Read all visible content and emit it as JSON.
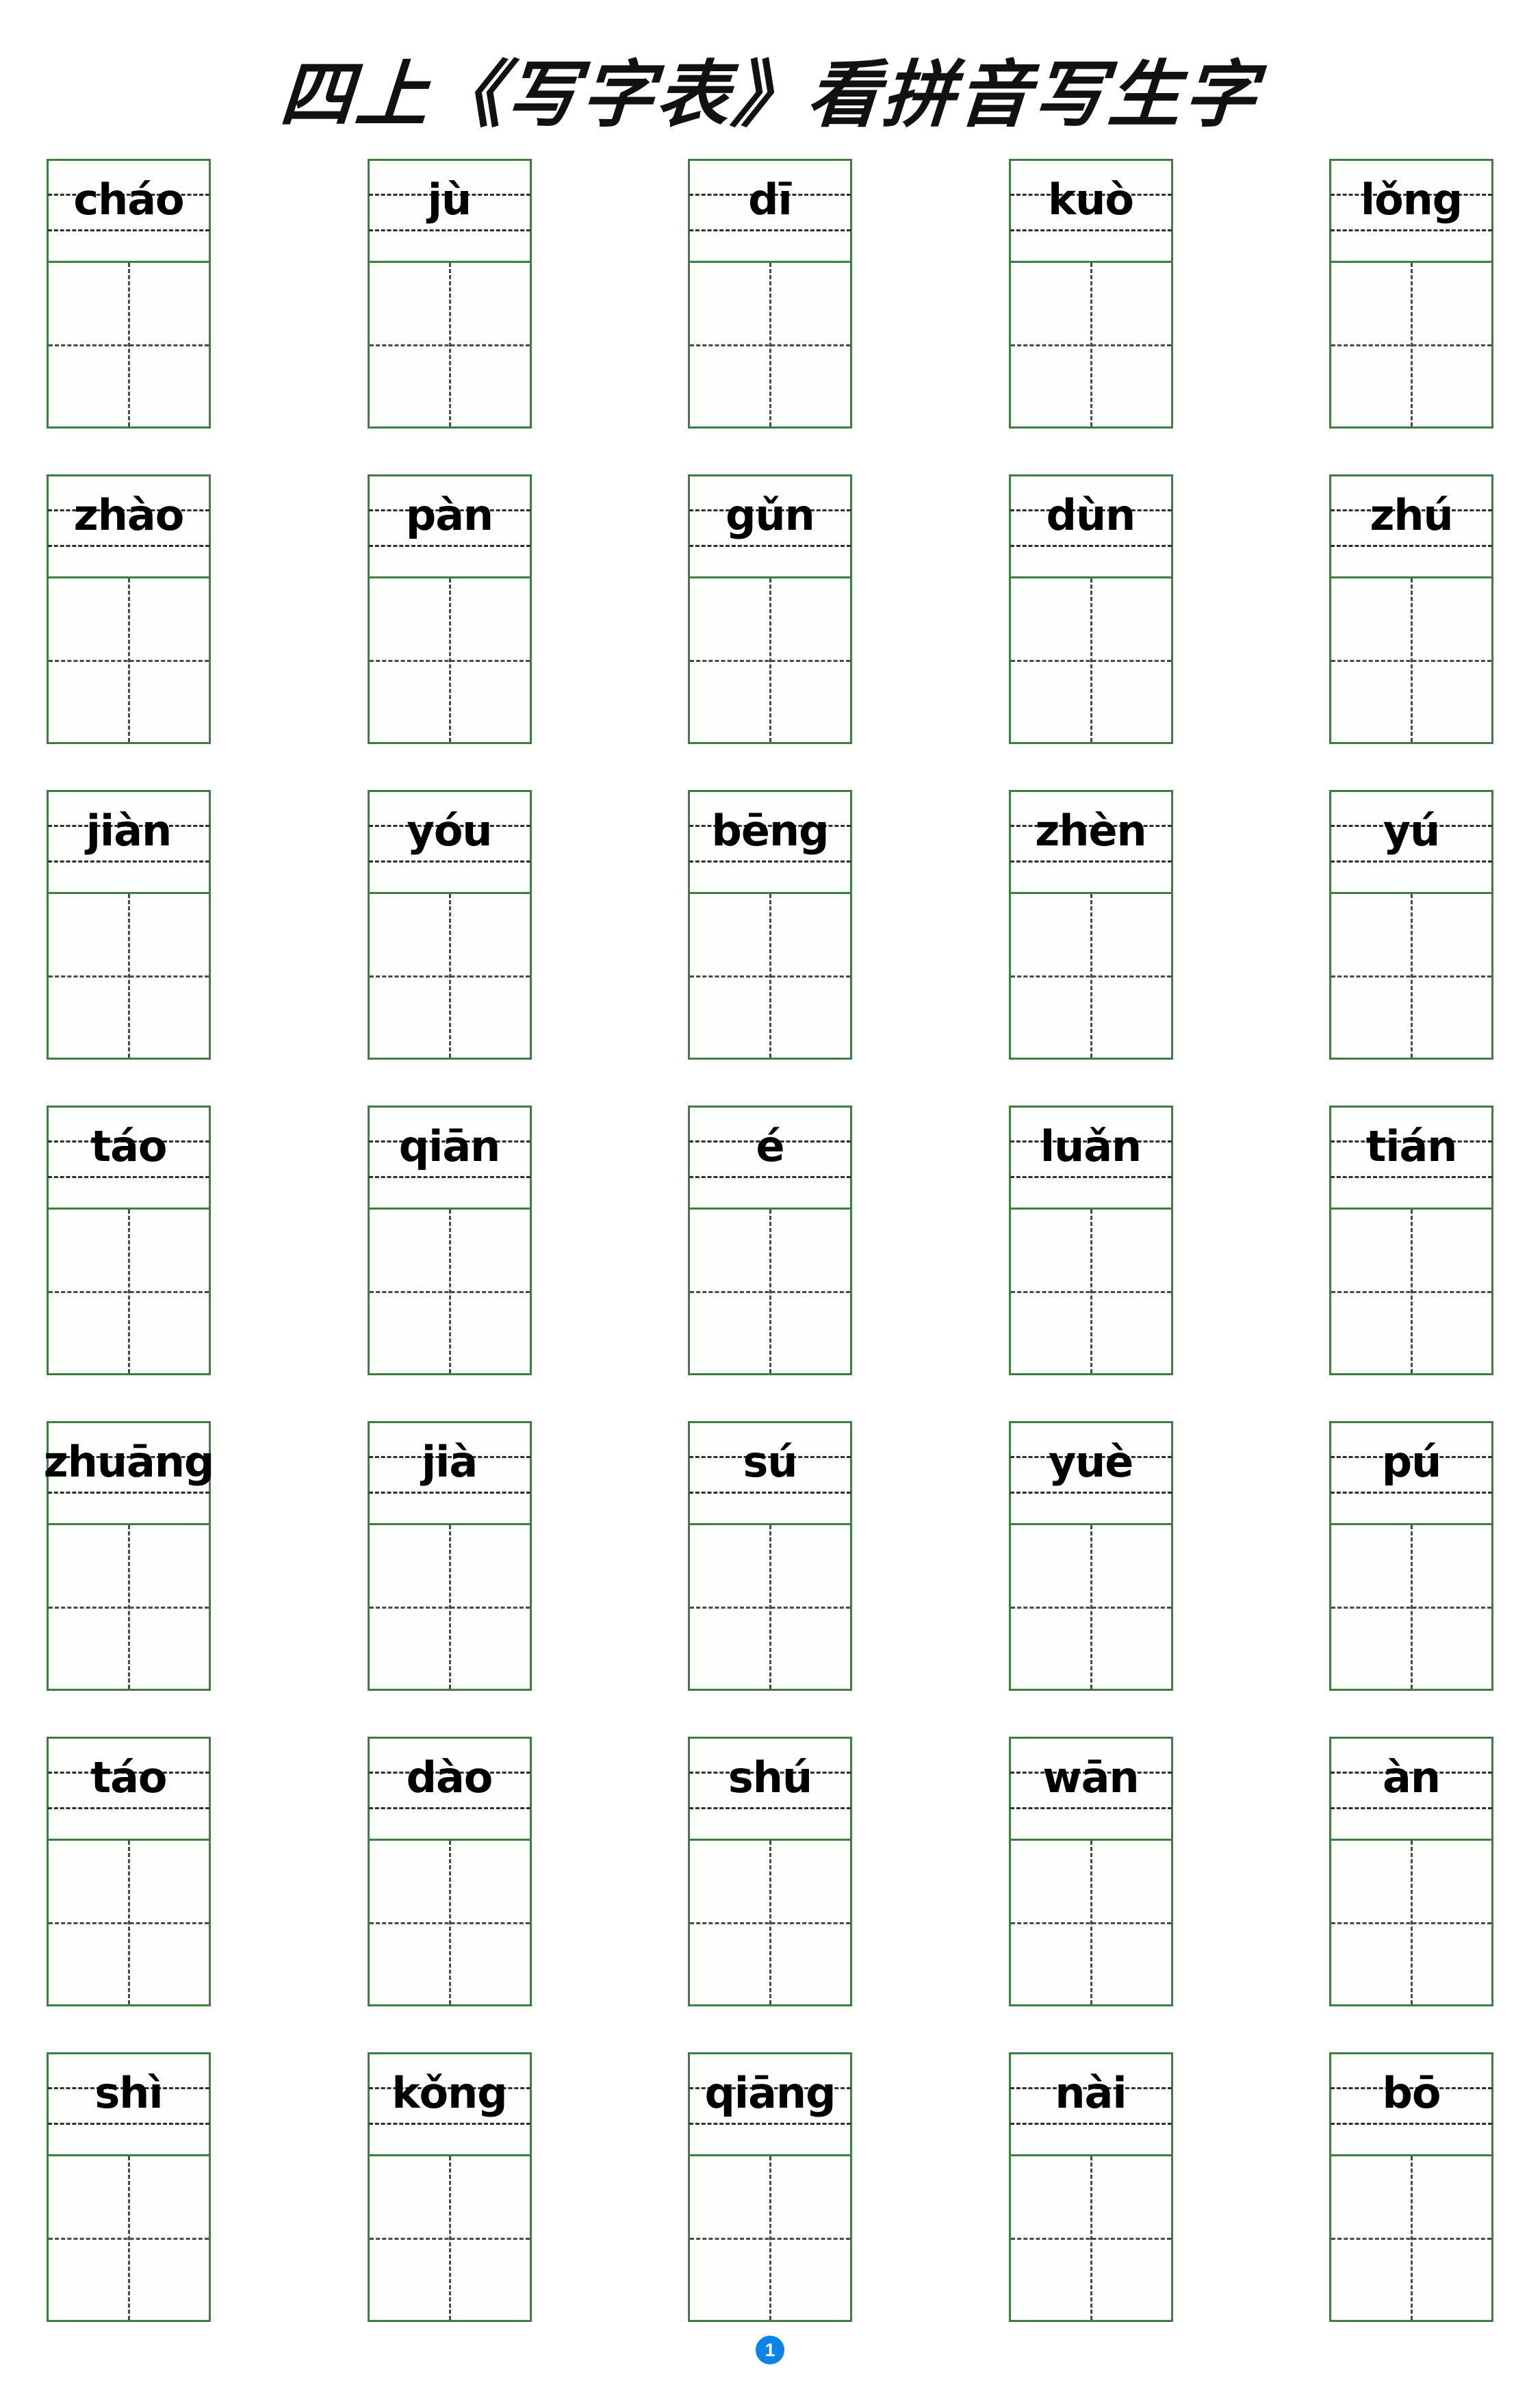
{
  "document": {
    "title": "四上《写字表》看拼音写生字",
    "page_number": "1",
    "page_badge_color": "#0a84e8",
    "grid_line_color": "#3f7d42",
    "guide_line_color": "#2f2f2f"
  },
  "worksheet": {
    "columns": 5,
    "rows": 7,
    "cell_structure": {
      "pinyin_guide": "four-line-three-grid",
      "character_grid": "tian-zi-ge"
    },
    "entries": [
      [
        {
          "pinyin": "cháo"
        },
        {
          "pinyin": "jù"
        },
        {
          "pinyin": "dī"
        },
        {
          "pinyin": "kuò"
        },
        {
          "pinyin": "lǒng"
        }
      ],
      [
        {
          "pinyin": "zhào"
        },
        {
          "pinyin": "pàn"
        },
        {
          "pinyin": "gǔn"
        },
        {
          "pinyin": "dùn"
        },
        {
          "pinyin": "zhú"
        }
      ],
      [
        {
          "pinyin": "jiàn"
        },
        {
          "pinyin": "yóu"
        },
        {
          "pinyin": "bēng"
        },
        {
          "pinyin": "zhèn"
        },
        {
          "pinyin": "yú"
        }
      ],
      [
        {
          "pinyin": "táo"
        },
        {
          "pinyin": "qiān"
        },
        {
          "pinyin": "é"
        },
        {
          "pinyin": "luǎn"
        },
        {
          "pinyin": "tián"
        }
      ],
      [
        {
          "pinyin": "zhuāng"
        },
        {
          "pinyin": "jià"
        },
        {
          "pinyin": "sú"
        },
        {
          "pinyin": "yuè"
        },
        {
          "pinyin": "pú"
        }
      ],
      [
        {
          "pinyin": "táo"
        },
        {
          "pinyin": "dào"
        },
        {
          "pinyin": "shú"
        },
        {
          "pinyin": "wān"
        },
        {
          "pinyin": "àn"
        }
      ],
      [
        {
          "pinyin": "shì"
        },
        {
          "pinyin": "kǒng"
        },
        {
          "pinyin": "qiāng"
        },
        {
          "pinyin": "nài"
        },
        {
          "pinyin": "bō"
        }
      ]
    ]
  }
}
